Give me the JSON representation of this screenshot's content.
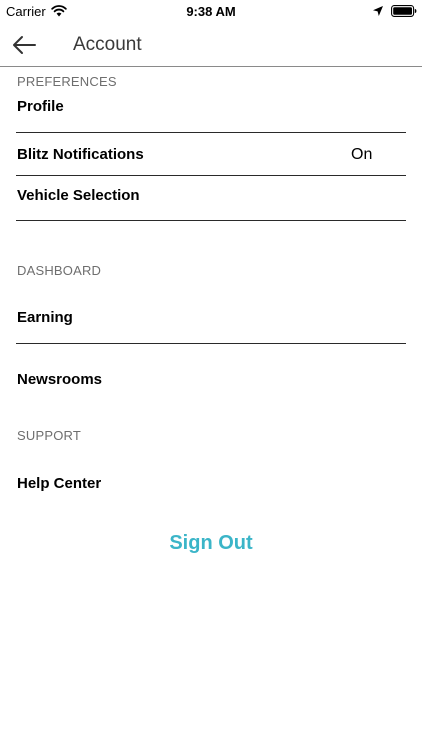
{
  "status_bar": {
    "carrier": "Carrier",
    "time": "9:38 AM",
    "icons": [
      "wifi-icon",
      "location-icon",
      "battery-icon"
    ]
  },
  "nav": {
    "back_icon": "back-arrow-icon",
    "title": "Account"
  },
  "sections": {
    "preferences": {
      "header": "PREFERENCES",
      "items": [
        {
          "label": "Profile"
        },
        {
          "label": "Blitz Notifications",
          "value": "On"
        },
        {
          "label": "Vehicle Selection"
        }
      ]
    },
    "dashboard": {
      "header": "DASHBOARD",
      "items": [
        {
          "label": "Earning"
        },
        {
          "label": "Newsrooms"
        }
      ]
    },
    "support": {
      "header": "SUPPORT",
      "items": [
        {
          "label": "Help Center"
        }
      ]
    }
  },
  "sign_out": {
    "label": "Sign Out"
  },
  "colors": {
    "accent": "#3bb5c8",
    "divider": "#2a2a2a",
    "section_header": "#6e6e6e"
  }
}
